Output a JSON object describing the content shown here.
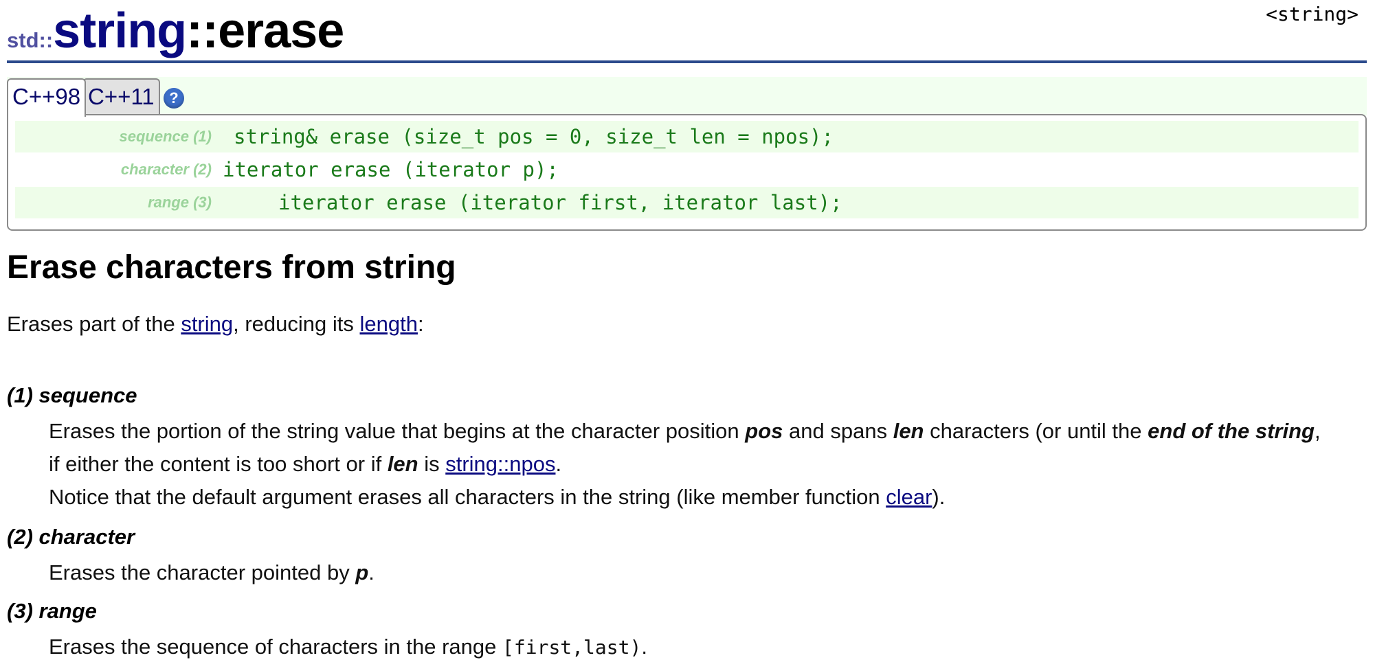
{
  "header_tag": "<string>",
  "title": {
    "ns": "std::",
    "cls": "string",
    "fn": "::erase"
  },
  "tabs": [
    {
      "label": "C++98",
      "active": true
    },
    {
      "label": "C++11",
      "active": false
    }
  ],
  "help_icon_glyph": "?",
  "prototypes": [
    {
      "label": "sequence (1)",
      "code": "string& erase (size_t pos = 0, size_t len = npos);"
    },
    {
      "label": "character (2)",
      "code": "iterator erase (iterator p);"
    },
    {
      "label": "range (3)",
      "code": "iterator erase (iterator first, iterator last);"
    }
  ],
  "heading": "Erase characters from string",
  "intro": {
    "t1": "Erases part of the ",
    "link1": "string",
    "t2": ", reducing its ",
    "link2": "length",
    "t3": ":"
  },
  "items": {
    "seq": {
      "term": "(1) sequence",
      "l1": {
        "a": "Erases the portion of the string value that begins at the character position ",
        "pos": "pos",
        "b": " and spans ",
        "len": "len",
        "c": " characters (or until the ",
        "end": "end of the string",
        "d": ","
      },
      "l2": {
        "a": "if either the content is too short or if ",
        "len": "len",
        "b": " is ",
        "link": "string::npos",
        "c": "."
      },
      "l3": {
        "a": "Notice that the default argument erases all characters in the string (like member function ",
        "link": "clear",
        "b": ")."
      }
    },
    "chr": {
      "term": "(2) character",
      "a": "Erases the character pointed by ",
      "p": "p",
      "b": "."
    },
    "rng": {
      "term": "(3) range",
      "a": "Erases the sequence of characters in the range ",
      "code": "[first,last)",
      "b": "."
    }
  },
  "colors": {
    "link": "#0a0a80",
    "code_green": "#1a7a1a",
    "label_green": "#9ad39a",
    "rule": "#2b4a8c",
    "tab_bg": "#f2fff0"
  }
}
